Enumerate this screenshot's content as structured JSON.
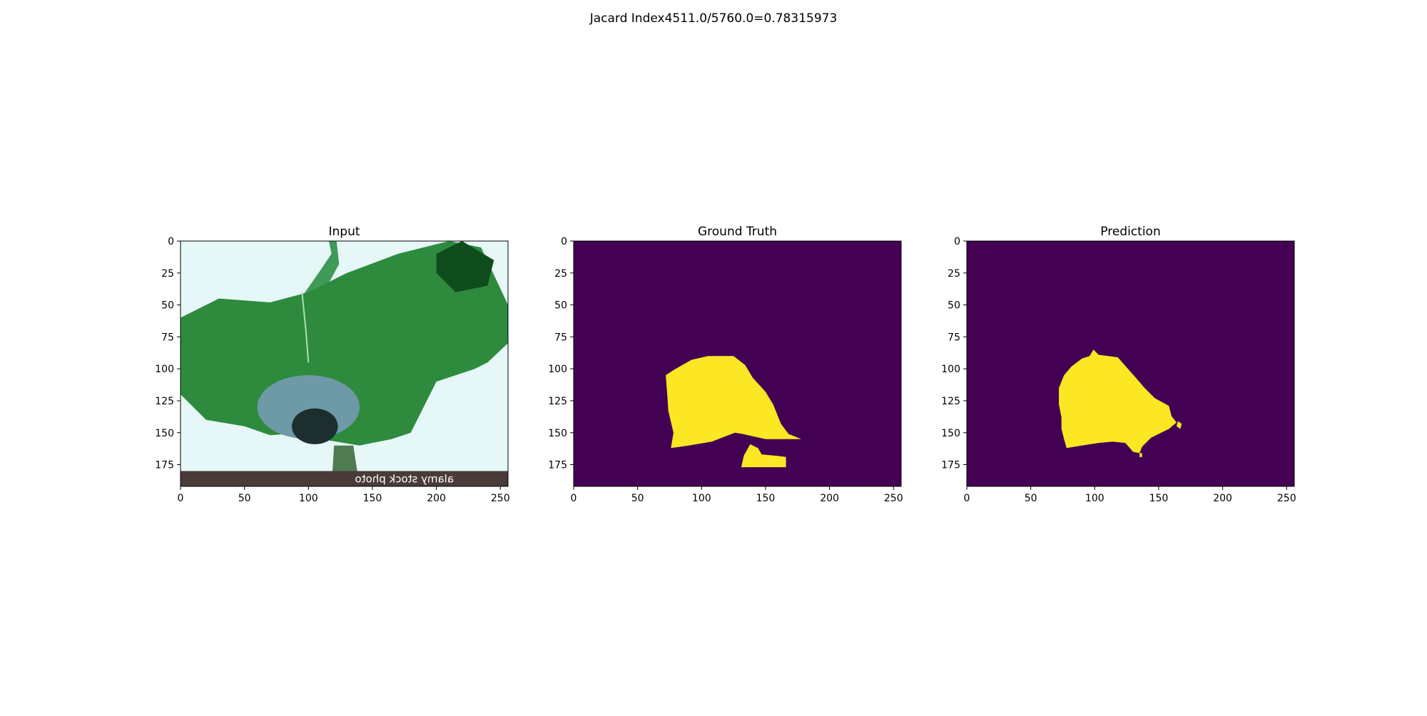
{
  "figure": {
    "suptitle": "Jacard Index4511.0/5760.0=0.78315973"
  },
  "colors": {
    "background_class": "#440154",
    "foreground_class": "#fde725",
    "leaf_green": "#2e8b3e",
    "leaf_dark": "#0f4d1c",
    "sky": "#e6f7f8",
    "watermark_bar": "#4a3b39"
  },
  "chart_data": [
    {
      "type": "heatmap",
      "title": "Input",
      "xlabel": "",
      "ylabel": "",
      "xlim": [
        0,
        256
      ],
      "ylim": [
        192,
        0
      ],
      "xticks": [
        0,
        50,
        100,
        150,
        200,
        250
      ],
      "yticks": [
        0,
        25,
        50,
        75,
        100,
        125,
        150,
        175
      ],
      "content": "rgb-photo",
      "photo_elements": [
        "green leaf",
        "diseased blue-grey patch",
        "stem",
        "watermark bar"
      ],
      "watermark_text": "alamy stock photo"
    },
    {
      "type": "heatmap",
      "title": "Ground Truth",
      "xlabel": "",
      "ylabel": "",
      "xlim": [
        0,
        256
      ],
      "ylim": [
        192,
        0
      ],
      "xticks": [
        0,
        50,
        100,
        150,
        200,
        250
      ],
      "yticks": [
        0,
        25,
        50,
        75,
        100,
        125,
        150,
        175
      ],
      "content": "binary-mask",
      "regions": [
        {
          "label": 1,
          "polygon": [
            [
              78,
              101
            ],
            [
              92,
              93
            ],
            [
              105,
              90
            ],
            [
              125,
              90
            ],
            [
              134,
              97
            ],
            [
              140,
              107
            ],
            [
              150,
              118
            ],
            [
              156,
              128
            ],
            [
              162,
              143
            ],
            [
              168,
              151
            ],
            [
              178,
              155
            ],
            [
              150,
              155
            ],
            [
              132,
              151
            ],
            [
              126,
              150
            ],
            [
              108,
              157
            ],
            [
              90,
              160
            ],
            [
              76,
              162
            ],
            [
              78,
              150
            ],
            [
              74,
              133
            ],
            [
              73,
              118
            ],
            [
              72,
              105
            ]
          ]
        },
        {
          "label": 1,
          "polygon": [
            [
              131,
              177
            ],
            [
              133,
              168
            ],
            [
              138,
              159
            ],
            [
              144,
              162
            ],
            [
              147,
              167
            ],
            [
              158,
              168
            ],
            [
              166,
              169
            ],
            [
              166,
              177
            ]
          ]
        }
      ]
    },
    {
      "type": "heatmap",
      "title": "Prediction",
      "xlabel": "",
      "ylabel": "",
      "xlim": [
        0,
        256
      ],
      "ylim": [
        192,
        0
      ],
      "xticks": [
        0,
        50,
        100,
        150,
        200,
        250
      ],
      "yticks": [
        0,
        25,
        50,
        75,
        100,
        125,
        150,
        175
      ],
      "content": "binary-mask",
      "regions": [
        {
          "label": 1,
          "polygon": [
            [
              76,
              105
            ],
            [
              82,
              98
            ],
            [
              90,
              92
            ],
            [
              96,
              90
            ],
            [
              99,
              85
            ],
            [
              103,
              89
            ],
            [
              118,
              91
            ],
            [
              126,
              100
            ],
            [
              133,
              108
            ],
            [
              139,
              115
            ],
            [
              147,
              123
            ],
            [
              158,
              129
            ],
            [
              160,
              137
            ],
            [
              164,
              142
            ],
            [
              158,
              147
            ],
            [
              150,
              151
            ],
            [
              144,
              154
            ],
            [
              137,
              161
            ],
            [
              135,
              166
            ],
            [
              130,
              165
            ],
            [
              124,
              158
            ],
            [
              114,
              157
            ],
            [
              103,
              158
            ],
            [
              90,
              160
            ],
            [
              78,
              162
            ],
            [
              76,
              155
            ],
            [
              74,
              147
            ],
            [
              74,
              138
            ],
            [
              72,
              128
            ],
            [
              72,
              115
            ]
          ]
        },
        {
          "label": 1,
          "polygon": [
            [
              165,
              141
            ],
            [
              168,
              143
            ],
            [
              167,
              147
            ],
            [
              164,
              145
            ]
          ]
        },
        {
          "label": 1,
          "polygon": [
            [
              135,
              166
            ],
            [
              137,
              166
            ],
            [
              137,
              169
            ],
            [
              135,
              169
            ]
          ]
        }
      ]
    }
  ]
}
